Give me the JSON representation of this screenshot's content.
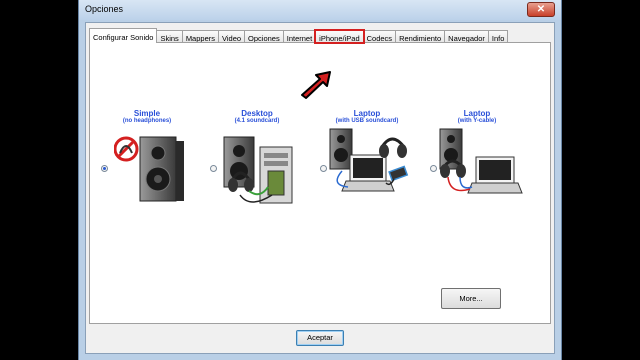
{
  "window": {
    "title": "Opciones",
    "close_glyph": "✕"
  },
  "tabs": [
    {
      "label": "Configurar Sonido"
    },
    {
      "label": "Skins"
    },
    {
      "label": "Mappers"
    },
    {
      "label": "Video"
    },
    {
      "label": "Opciones"
    },
    {
      "label": "Internet"
    },
    {
      "label": "iPhone/iPad"
    },
    {
      "label": "Codecs"
    },
    {
      "label": "Rendimiento"
    },
    {
      "label": "Navegador"
    },
    {
      "label": "Info"
    }
  ],
  "active_tab": "Configurar Sonido",
  "highlighted_tab": "iPhone/iPad",
  "options": [
    {
      "title": "Simple",
      "subtitle": "(no headphones)",
      "selected": true
    },
    {
      "title": "Desktop",
      "subtitle": "(4.1 soundcard)",
      "selected": false
    },
    {
      "title": "Laptop",
      "subtitle": "(with USB soundcard)",
      "selected": false
    },
    {
      "title": "Laptop",
      "subtitle": "(with Y-cable)",
      "selected": false
    }
  ],
  "buttons": {
    "more": "More...",
    "accept": "Aceptar"
  },
  "colors": {
    "option_text": "#2a50d8",
    "highlight": "#d42020",
    "arrow": "#d42020"
  }
}
